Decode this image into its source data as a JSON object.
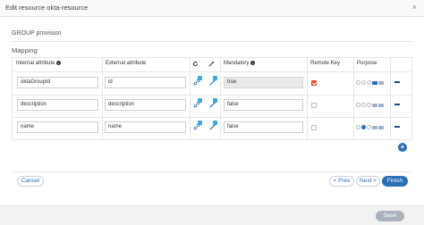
{
  "modal": {
    "title": "Edit resource okta-resource",
    "close_glyph": "×"
  },
  "section": {
    "title": "GROUP provision"
  },
  "mapping": {
    "title": "Mapping",
    "columns": {
      "internal": "Internal attribute",
      "external": "External attribute",
      "mandatory": "Mandatory",
      "remote_key": "Remote Key",
      "purpose": "Purpose"
    },
    "rows": [
      {
        "internal": "oktaGroupId",
        "external": "id",
        "mandatory": "true",
        "remote_key": true
      },
      {
        "internal": "description",
        "external": "description",
        "mandatory": "false",
        "remote_key": false
      },
      {
        "internal": "name",
        "external": "name",
        "mandatory": "false",
        "remote_key": false
      }
    ],
    "add_glyph": "+"
  },
  "buttons": {
    "cancel": "Cancel",
    "prev": "< Prev",
    "next": "Next >",
    "finish": "Finish",
    "save": "Save"
  },
  "colors": {
    "primary": "#2a6fb4",
    "badge": "#41a7dd",
    "remote_key_on": "#e3513c"
  }
}
